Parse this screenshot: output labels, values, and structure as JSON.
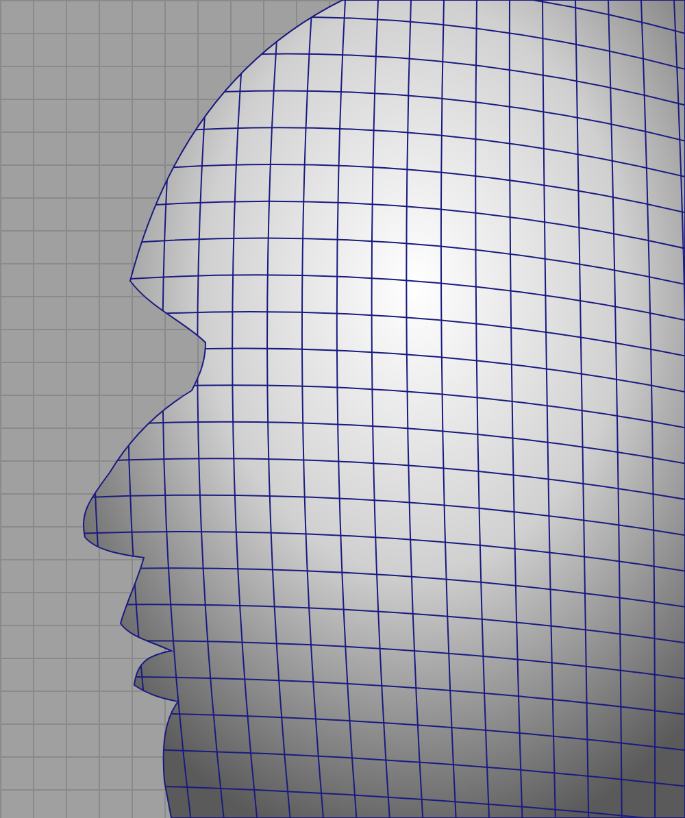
{
  "viewport": {
    "grid_visible": true,
    "wireframe_on_shaded": true
  }
}
